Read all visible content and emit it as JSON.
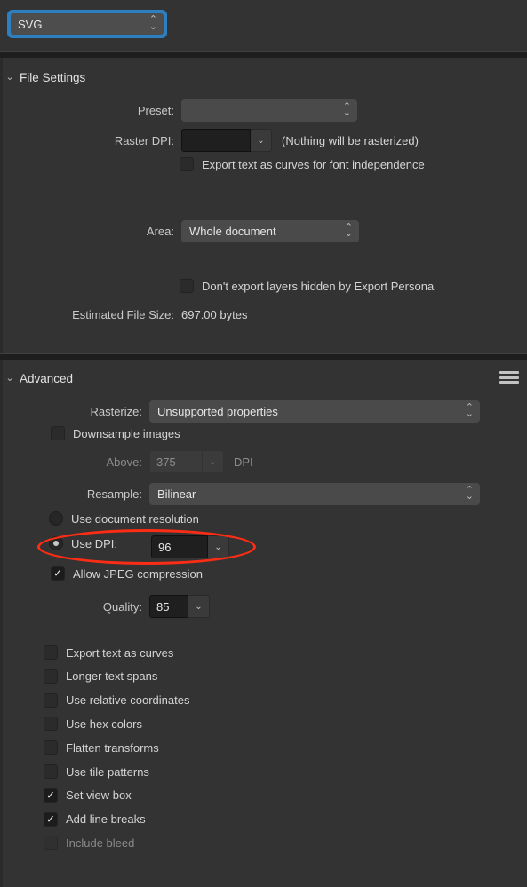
{
  "format_selector": {
    "value": "SVG",
    "focused": true
  },
  "file_settings": {
    "title": "File Settings",
    "preset": {
      "label": "Preset:",
      "value": ""
    },
    "raster_dpi": {
      "label": "Raster DPI:",
      "value": "",
      "note": "(Nothing will be rasterized)"
    },
    "export_text_curves": {
      "label": "Export text as curves for font independence",
      "checked": false
    },
    "area": {
      "label": "Area:",
      "value": "Whole document"
    },
    "dont_export_hidden": {
      "label": "Don't export layers hidden by Export Persona",
      "checked": false
    },
    "estimated_size": {
      "label": "Estimated File Size:",
      "value": "697.00 bytes"
    }
  },
  "advanced": {
    "title": "Advanced",
    "menu_icon": "hamburger-icon",
    "rasterize": {
      "label": "Rasterize:",
      "value": "Unsupported properties"
    },
    "downsample_images": {
      "label": "Downsample images",
      "checked": false
    },
    "above": {
      "label": "Above:",
      "value": "375",
      "unit": "DPI",
      "disabled": true
    },
    "resample": {
      "label": "Resample:",
      "value": "Bilinear"
    },
    "use_document_resolution": {
      "label": "Use document resolution",
      "selected": false
    },
    "use_dpi": {
      "label": "Use DPI:",
      "value": "96",
      "selected": true,
      "highlighted": true
    },
    "allow_jpeg_compression": {
      "label": "Allow JPEG compression",
      "checked": true
    },
    "quality": {
      "label": "Quality:",
      "value": "85"
    },
    "options": [
      {
        "label": "Export text as curves",
        "checked": false,
        "disabled": false
      },
      {
        "label": "Longer text spans",
        "checked": false,
        "disabled": false
      },
      {
        "label": "Use relative coordinates",
        "checked": false,
        "disabled": false
      },
      {
        "label": "Use hex colors",
        "checked": false,
        "disabled": false
      },
      {
        "label": "Flatten transforms",
        "checked": false,
        "disabled": false
      },
      {
        "label": "Use tile patterns",
        "checked": false,
        "disabled": false
      },
      {
        "label": "Set view box",
        "checked": true,
        "disabled": false
      },
      {
        "label": "Add line breaks",
        "checked": true,
        "disabled": false
      },
      {
        "label": "Include bleed",
        "checked": false,
        "disabled": true
      }
    ]
  },
  "colors": {
    "background": "#333333",
    "focus_ring": "#2d7fc0",
    "annotation": "#fb2d14"
  }
}
